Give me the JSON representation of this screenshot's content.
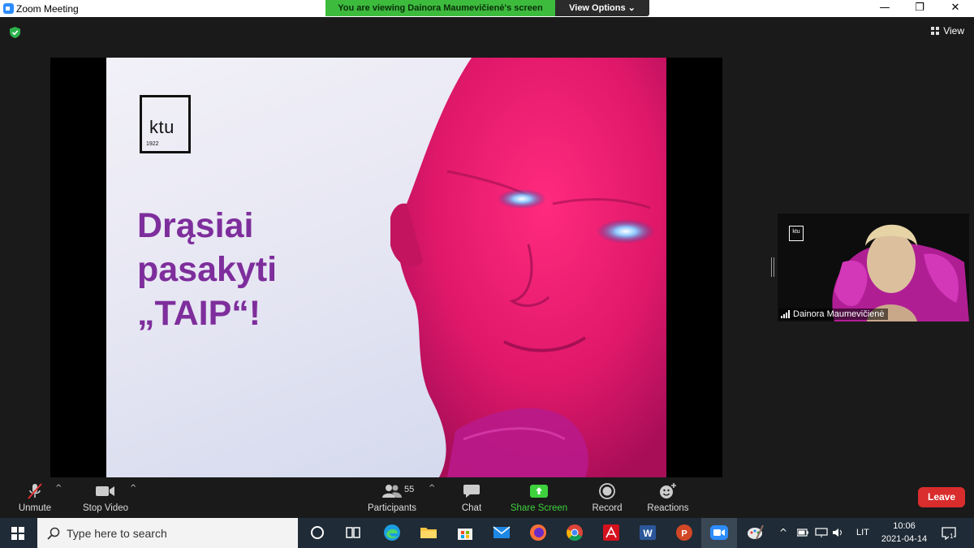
{
  "window": {
    "title": "Zoom Meeting",
    "minimize_glyph": "—",
    "restore_glyph": "❐",
    "close_glyph": "✕"
  },
  "banner": {
    "viewing_text": "You are viewing Dainora Maumevičienė's screen",
    "view_options_label": "View Options ⌄"
  },
  "meeting": {
    "view_label": "View",
    "slide": {
      "logo_text": "ktu",
      "logo_year": "1922",
      "headline_lines": [
        "Drąsiai",
        "pasakyti",
        "„TAIP“!"
      ]
    },
    "participant": {
      "name": "Dainora Maumevičienė",
      "tile_logo_text": "ktu"
    }
  },
  "toolbar": {
    "unmute_label": "Unmute",
    "stop_video_label": "Stop Video",
    "participants_label": "Participants",
    "participants_count": "55",
    "chat_label": "Chat",
    "share_screen_label": "Share Screen",
    "record_label": "Record",
    "reactions_label": "Reactions",
    "leave_label": "Leave",
    "caret_glyph": "^"
  },
  "taskbar": {
    "search_placeholder": "Type here to search",
    "language": "LIT",
    "time": "10:06",
    "date": "2021-04-14",
    "notification_count": "1"
  },
  "colors": {
    "share_green": "#3dd13d",
    "leave_red": "#d92d2d",
    "headline_purple": "#7e2e9c",
    "robot_magenta": "#e0186a"
  }
}
